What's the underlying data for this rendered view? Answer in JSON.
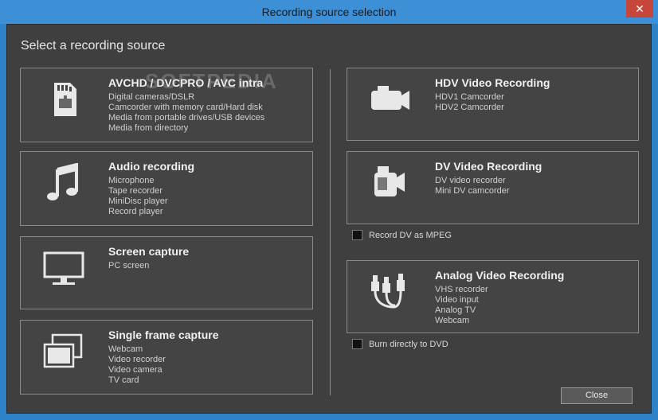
{
  "window": {
    "title": "Recording source selection",
    "close_glyph": "✕"
  },
  "heading": "Select a recording source",
  "watermark": "SOFTPEDIA",
  "left_cards": [
    {
      "title": "AVCHD / DVCPRO / AVC intra",
      "icon": "sd-card-icon",
      "lines": [
        "Digital cameras/DSLR",
        "Camcorder with memory card/Hard disk",
        "Media from portable drives/USB devices",
        "Media from directory"
      ]
    },
    {
      "title": "Audio recording",
      "icon": "music-note-icon",
      "lines": [
        "Microphone",
        "Tape recorder",
        "MiniDisc player",
        "Record player"
      ]
    },
    {
      "title": "Screen capture",
      "icon": "monitor-icon",
      "lines": [
        "PC screen"
      ]
    },
    {
      "title": "Single frame capture",
      "icon": "frames-icon",
      "lines": [
        "Webcam",
        "Video recorder",
        "Video camera",
        "TV card"
      ]
    }
  ],
  "right_cards": [
    {
      "title": "HDV Video Recording",
      "icon": "hdv-camera-icon",
      "lines": [
        "HDV1 Camcorder",
        "HDV2 Camcorder"
      ]
    },
    {
      "title": "DV Video Recording",
      "icon": "dv-camera-icon",
      "lines": [
        "DV video recorder",
        "Mini DV camcorder"
      ]
    },
    {
      "title": "Analog Video Recording",
      "icon": "av-cable-icon",
      "lines": [
        "VHS recorder",
        "Video input",
        "Analog TV",
        "Webcam"
      ]
    }
  ],
  "checkboxes": {
    "dv_mpeg": "Record DV as MPEG",
    "burn_dvd": "Burn directly to DVD"
  },
  "close_button": "Close"
}
